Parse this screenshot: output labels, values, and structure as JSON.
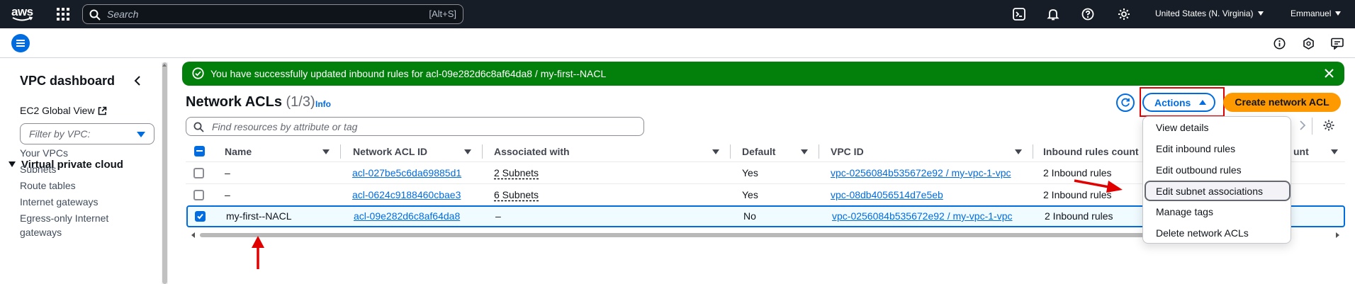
{
  "topnav": {
    "logo_text": "aws",
    "search_placeholder": "Search",
    "search_shortcut": "[Alt+S]",
    "region": "United States (N. Virginia)",
    "user": "Emmanuel"
  },
  "sidebar": {
    "title": "VPC dashboard",
    "ec2_global_view": "EC2 Global View",
    "filter_placeholder": "Filter by VPC:",
    "section": "Virtual private cloud",
    "items": [
      "Your VPCs",
      "Subnets",
      "Route tables",
      "Internet gateways",
      "Egress-only Internet gateways"
    ]
  },
  "flash": {
    "message": "You have successfully updated inbound rules for acl-09e282d6c8af64da8 / my-first--NACL"
  },
  "header": {
    "title": "Network ACLs",
    "count": "(1/3)",
    "info": "Info",
    "actions_label": "Actions",
    "create_label": "Create network ACL",
    "search_placeholder": "Find resources by attribute or tag"
  },
  "table": {
    "columns": [
      "Name",
      "Network ACL ID",
      "Associated with",
      "Default",
      "VPC ID",
      "Inbound rules count",
      "unt"
    ],
    "rows": [
      {
        "name": "–",
        "acl_id": "acl-027be5c6da69885d1",
        "associated": "2 Subnets",
        "default": "Yes",
        "vpc": "vpc-0256084b535672e92 / my-vpc-1-vpc",
        "inbound": "2 Inbound rules",
        "selected": false
      },
      {
        "name": "–",
        "acl_id": "acl-0624c9188460cbae3",
        "associated": "6 Subnets",
        "default": "Yes",
        "vpc": "vpc-08db4056514d7e5eb",
        "inbound": "2 Inbound rules",
        "selected": false
      },
      {
        "name": "my-first--NACL",
        "acl_id": "acl-09e282d6c8af64da8",
        "associated": "–",
        "default": "No",
        "vpc": "vpc-0256084b535672e92 / my-vpc-1-vpc",
        "inbound": "2 Inbound rules",
        "selected": true
      }
    ]
  },
  "actions_menu": {
    "items": [
      "View details",
      "Edit inbound rules",
      "Edit outbound rules",
      "Edit subnet associations",
      "Manage tags",
      "Delete network ACLs"
    ],
    "highlighted": "Edit subnet associations"
  },
  "colors": {
    "nav_bg": "#161d26",
    "accent": "#006ce0",
    "success": "#037f0c",
    "primary_button": "#ff9900",
    "annotation": "#e00000"
  }
}
